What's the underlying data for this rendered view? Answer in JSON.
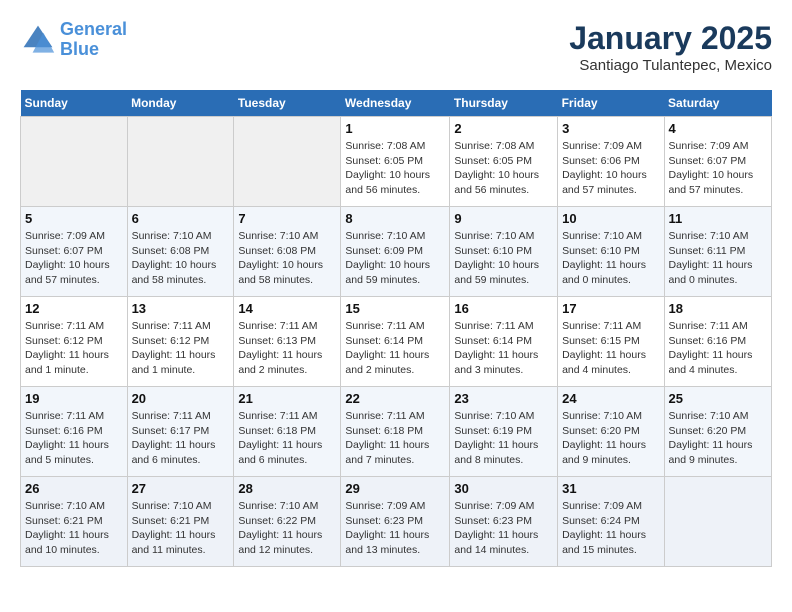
{
  "header": {
    "logo_line1": "General",
    "logo_line2": "Blue",
    "month": "January 2025",
    "location": "Santiago Tulantepec, Mexico"
  },
  "weekdays": [
    "Sunday",
    "Monday",
    "Tuesday",
    "Wednesday",
    "Thursday",
    "Friday",
    "Saturday"
  ],
  "weeks": [
    [
      {
        "day": "",
        "sunrise": "",
        "sunset": "",
        "daylight": ""
      },
      {
        "day": "",
        "sunrise": "",
        "sunset": "",
        "daylight": ""
      },
      {
        "day": "",
        "sunrise": "",
        "sunset": "",
        "daylight": ""
      },
      {
        "day": "1",
        "sunrise": "Sunrise: 7:08 AM",
        "sunset": "Sunset: 6:05 PM",
        "daylight": "Daylight: 10 hours and 56 minutes."
      },
      {
        "day": "2",
        "sunrise": "Sunrise: 7:08 AM",
        "sunset": "Sunset: 6:05 PM",
        "daylight": "Daylight: 10 hours and 56 minutes."
      },
      {
        "day": "3",
        "sunrise": "Sunrise: 7:09 AM",
        "sunset": "Sunset: 6:06 PM",
        "daylight": "Daylight: 10 hours and 57 minutes."
      },
      {
        "day": "4",
        "sunrise": "Sunrise: 7:09 AM",
        "sunset": "Sunset: 6:07 PM",
        "daylight": "Daylight: 10 hours and 57 minutes."
      }
    ],
    [
      {
        "day": "5",
        "sunrise": "Sunrise: 7:09 AM",
        "sunset": "Sunset: 6:07 PM",
        "daylight": "Daylight: 10 hours and 57 minutes."
      },
      {
        "day": "6",
        "sunrise": "Sunrise: 7:10 AM",
        "sunset": "Sunset: 6:08 PM",
        "daylight": "Daylight: 10 hours and 58 minutes."
      },
      {
        "day": "7",
        "sunrise": "Sunrise: 7:10 AM",
        "sunset": "Sunset: 6:08 PM",
        "daylight": "Daylight: 10 hours and 58 minutes."
      },
      {
        "day": "8",
        "sunrise": "Sunrise: 7:10 AM",
        "sunset": "Sunset: 6:09 PM",
        "daylight": "Daylight: 10 hours and 59 minutes."
      },
      {
        "day": "9",
        "sunrise": "Sunrise: 7:10 AM",
        "sunset": "Sunset: 6:10 PM",
        "daylight": "Daylight: 10 hours and 59 minutes."
      },
      {
        "day": "10",
        "sunrise": "Sunrise: 7:10 AM",
        "sunset": "Sunset: 6:10 PM",
        "daylight": "Daylight: 11 hours and 0 minutes."
      },
      {
        "day": "11",
        "sunrise": "Sunrise: 7:10 AM",
        "sunset": "Sunset: 6:11 PM",
        "daylight": "Daylight: 11 hours and 0 minutes."
      }
    ],
    [
      {
        "day": "12",
        "sunrise": "Sunrise: 7:11 AM",
        "sunset": "Sunset: 6:12 PM",
        "daylight": "Daylight: 11 hours and 1 minute."
      },
      {
        "day": "13",
        "sunrise": "Sunrise: 7:11 AM",
        "sunset": "Sunset: 6:12 PM",
        "daylight": "Daylight: 11 hours and 1 minute."
      },
      {
        "day": "14",
        "sunrise": "Sunrise: 7:11 AM",
        "sunset": "Sunset: 6:13 PM",
        "daylight": "Daylight: 11 hours and 2 minutes."
      },
      {
        "day": "15",
        "sunrise": "Sunrise: 7:11 AM",
        "sunset": "Sunset: 6:14 PM",
        "daylight": "Daylight: 11 hours and 2 minutes."
      },
      {
        "day": "16",
        "sunrise": "Sunrise: 7:11 AM",
        "sunset": "Sunset: 6:14 PM",
        "daylight": "Daylight: 11 hours and 3 minutes."
      },
      {
        "day": "17",
        "sunrise": "Sunrise: 7:11 AM",
        "sunset": "Sunset: 6:15 PM",
        "daylight": "Daylight: 11 hours and 4 minutes."
      },
      {
        "day": "18",
        "sunrise": "Sunrise: 7:11 AM",
        "sunset": "Sunset: 6:16 PM",
        "daylight": "Daylight: 11 hours and 4 minutes."
      }
    ],
    [
      {
        "day": "19",
        "sunrise": "Sunrise: 7:11 AM",
        "sunset": "Sunset: 6:16 PM",
        "daylight": "Daylight: 11 hours and 5 minutes."
      },
      {
        "day": "20",
        "sunrise": "Sunrise: 7:11 AM",
        "sunset": "Sunset: 6:17 PM",
        "daylight": "Daylight: 11 hours and 6 minutes."
      },
      {
        "day": "21",
        "sunrise": "Sunrise: 7:11 AM",
        "sunset": "Sunset: 6:18 PM",
        "daylight": "Daylight: 11 hours and 6 minutes."
      },
      {
        "day": "22",
        "sunrise": "Sunrise: 7:11 AM",
        "sunset": "Sunset: 6:18 PM",
        "daylight": "Daylight: 11 hours and 7 minutes."
      },
      {
        "day": "23",
        "sunrise": "Sunrise: 7:10 AM",
        "sunset": "Sunset: 6:19 PM",
        "daylight": "Daylight: 11 hours and 8 minutes."
      },
      {
        "day": "24",
        "sunrise": "Sunrise: 7:10 AM",
        "sunset": "Sunset: 6:20 PM",
        "daylight": "Daylight: 11 hours and 9 minutes."
      },
      {
        "day": "25",
        "sunrise": "Sunrise: 7:10 AM",
        "sunset": "Sunset: 6:20 PM",
        "daylight": "Daylight: 11 hours and 9 minutes."
      }
    ],
    [
      {
        "day": "26",
        "sunrise": "Sunrise: 7:10 AM",
        "sunset": "Sunset: 6:21 PM",
        "daylight": "Daylight: 11 hours and 10 minutes."
      },
      {
        "day": "27",
        "sunrise": "Sunrise: 7:10 AM",
        "sunset": "Sunset: 6:21 PM",
        "daylight": "Daylight: 11 hours and 11 minutes."
      },
      {
        "day": "28",
        "sunrise": "Sunrise: 7:10 AM",
        "sunset": "Sunset: 6:22 PM",
        "daylight": "Daylight: 11 hours and 12 minutes."
      },
      {
        "day": "29",
        "sunrise": "Sunrise: 7:09 AM",
        "sunset": "Sunset: 6:23 PM",
        "daylight": "Daylight: 11 hours and 13 minutes."
      },
      {
        "day": "30",
        "sunrise": "Sunrise: 7:09 AM",
        "sunset": "Sunset: 6:23 PM",
        "daylight": "Daylight: 11 hours and 14 minutes."
      },
      {
        "day": "31",
        "sunrise": "Sunrise: 7:09 AM",
        "sunset": "Sunset: 6:24 PM",
        "daylight": "Daylight: 11 hours and 15 minutes."
      },
      {
        "day": "",
        "sunrise": "",
        "sunset": "",
        "daylight": ""
      }
    ]
  ]
}
